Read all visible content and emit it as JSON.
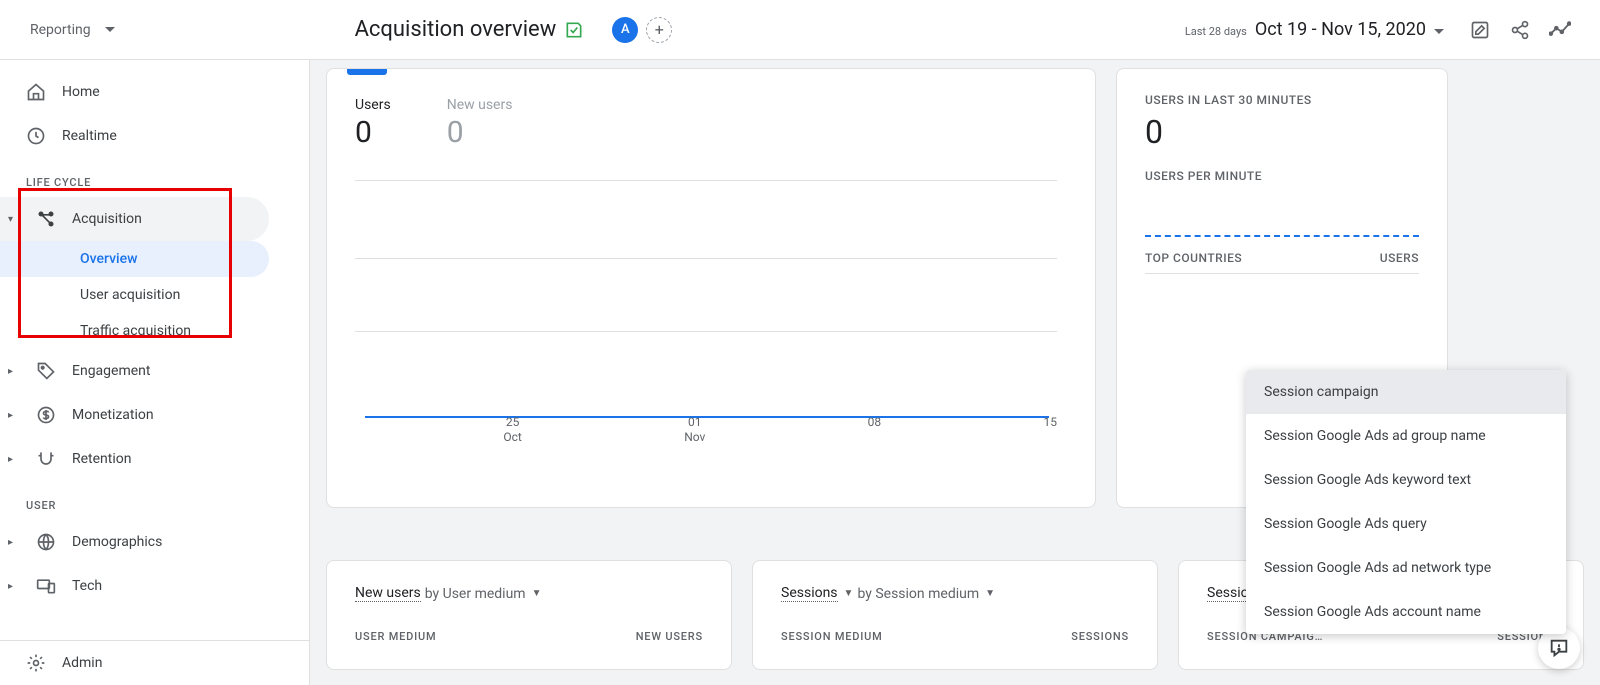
{
  "header": {
    "reporting_label": "Reporting",
    "title": "Acquisition overview",
    "badge": "A",
    "date_label": "Last 28 days",
    "date_range": "Oct 19 - Nov 15, 2020"
  },
  "sidebar": {
    "home": "Home",
    "realtime": "Realtime",
    "section_life_cycle": "LIFE CYCLE",
    "acquisition": "Acquisition",
    "overview": "Overview",
    "user_acquisition": "User acquisition",
    "traffic_acquisition": "Traffic acquisition",
    "engagement": "Engagement",
    "monetization": "Monetization",
    "retention": "Retention",
    "section_user": "USER",
    "demographics": "Demographics",
    "tech": "Tech",
    "admin": "Admin"
  },
  "chart_data": {
    "type": "line",
    "series": [
      {
        "name": "Users",
        "values": [
          0,
          0,
          0,
          0,
          0,
          0,
          0,
          0,
          0,
          0,
          0,
          0,
          0,
          0,
          0,
          0,
          0,
          0,
          0,
          0,
          0,
          0,
          0,
          0,
          0,
          0,
          0,
          0
        ]
      }
    ],
    "x_ticks": [
      "25\nOct",
      "01\nNov",
      "08",
      "15"
    ],
    "tabs": [
      {
        "label": "Users",
        "value": "0",
        "active": true
      },
      {
        "label": "New users",
        "value": "0",
        "active": false
      }
    ],
    "ylim": [
      0,
      0
    ]
  },
  "realtime_card": {
    "title": "USERS IN LAST 30 MINUTES",
    "value": "0",
    "subtitle": "USERS PER MINUTE",
    "col_left": "TOP COUNTRIES",
    "col_right": "USERS"
  },
  "small_cards": [
    {
      "title_link": "New users",
      "title_rest": "by User medium",
      "has_second_caret": false,
      "col_left": "USER MEDIUM",
      "col_right": "NEW USERS"
    },
    {
      "title_link": "Sessions",
      "title_rest": "by Session medium",
      "has_second_caret": false,
      "col_left": "SESSION MEDIUM",
      "col_right": "SESSIONS"
    },
    {
      "title_link": "Sessions",
      "title_rest": "",
      "has_second_caret": true,
      "col_left": "SESSION CAMPAIG…",
      "col_right": "SESSIONS"
    }
  ],
  "popover": {
    "items": [
      "Session campaign",
      "Session Google Ads ad group name",
      "Session Google Ads keyword text",
      "Session Google Ads query",
      "Session Google Ads ad network type",
      "Session Google Ads account name"
    ],
    "selected_index": 0
  }
}
